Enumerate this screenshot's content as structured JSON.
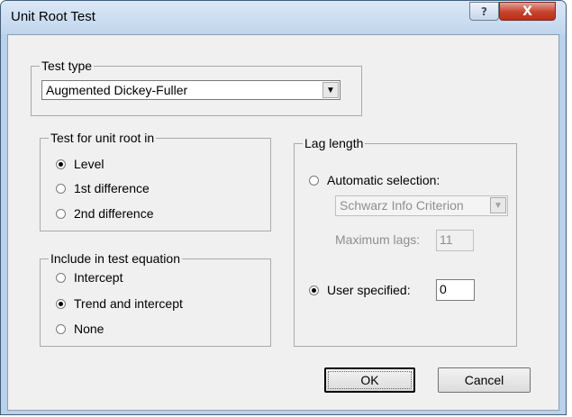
{
  "window": {
    "title": "Unit Root Test",
    "help_glyph": "?",
    "close_glyph": "X"
  },
  "test_type": {
    "label": "Test type",
    "selected": "Augmented Dickey-Fuller",
    "arrow_glyph": "▼"
  },
  "unit_root_in": {
    "label": "Test for unit root in",
    "options": [
      {
        "label": "Level",
        "checked": true
      },
      {
        "label": "1st difference",
        "checked": false
      },
      {
        "label": "2nd difference",
        "checked": false
      }
    ]
  },
  "test_equation": {
    "label": "Include in test equation",
    "options": [
      {
        "label": "Intercept",
        "checked": false
      },
      {
        "label": "Trend and intercept",
        "checked": true
      },
      {
        "label": "None",
        "checked": false
      }
    ]
  },
  "lag_length": {
    "label": "Lag length",
    "automatic": {
      "label": "Automatic selection:",
      "checked": false
    },
    "criterion": {
      "selected": "Schwarz Info Criterion",
      "enabled": false,
      "arrow_glyph": "▼"
    },
    "max_lags": {
      "label": "Maximum lags:",
      "value": "11",
      "enabled": false
    },
    "user_specified": {
      "label": "User specified:",
      "checked": true,
      "value": "0"
    }
  },
  "buttons": {
    "ok": "OK",
    "cancel": "Cancel"
  }
}
